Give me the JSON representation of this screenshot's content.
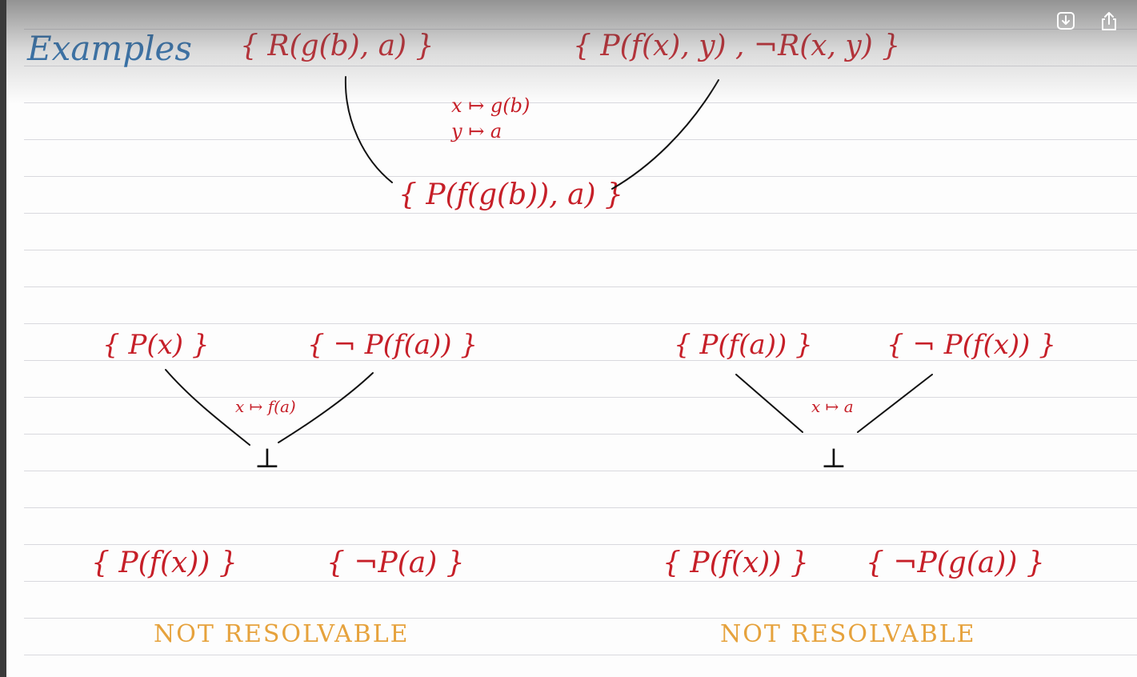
{
  "heading": "Examples",
  "example1": {
    "clause_left": "{ R(g(b), a) }",
    "clause_right": "{ P(f(x), y) , ¬R(x, y) }",
    "subst_1": "x ↦ g(b)",
    "subst_2": "y ↦ a",
    "resolvent": "{ P(f(g(b)), a) }"
  },
  "example2": {
    "clause_left": "{ P(x) }",
    "clause_right": "{ ¬ P(f(a)) }",
    "subst": "x ↦ f(a)",
    "result": "⊥"
  },
  "example3": {
    "clause_left": "{ P(f(a)) }",
    "clause_right": "{ ¬ P(f(x)) }",
    "subst": "x ↦ a",
    "result": "⊥"
  },
  "example4": {
    "clause_left": "{ P(f(x)) }",
    "clause_right": "{ ¬P(a) }",
    "verdict": "NOT RESOLVABLE"
  },
  "example5": {
    "clause_left": "{ P(f(x)) }",
    "clause_right": "{ ¬P(g(a)) }",
    "verdict": "NOT RESOLVABLE"
  },
  "toolbar": {
    "download_icon": "download-icon",
    "share_icon": "share-icon"
  },
  "colors": {
    "red_ink": "#c61f28",
    "blue_ink": "#2a6fb0",
    "orange_ink": "#e6a23c",
    "rules": "#d9d9de"
  }
}
